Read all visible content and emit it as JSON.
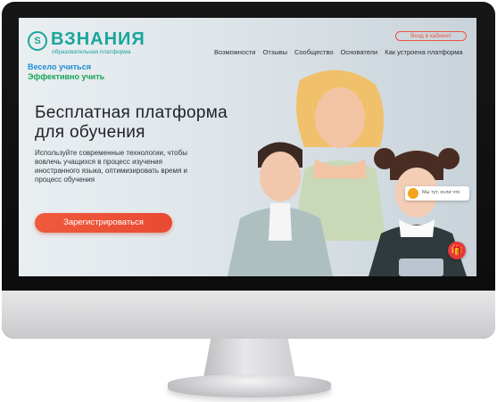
{
  "brand": {
    "logo_mark": "S",
    "name": "ВЗНАНИЯ",
    "subtitle": "образовательная платформа"
  },
  "header": {
    "login_label": "Вход в кабинет",
    "nav": [
      "Возможности",
      "Отзывы",
      "Сообщество",
      "Основатели",
      "Как устроена платформа"
    ]
  },
  "slogan": {
    "line1": "Весело учиться",
    "line2": "Эффективно учить"
  },
  "hero": {
    "title": "Бесплатная платформа для обучения",
    "description": "Используйте современные технологии, чтобы вовлечь учащихся в процесс изучения иностранного языка, оптимизировать время и процесс обучения",
    "register_label": "Зарегистрироваться"
  },
  "chat": {
    "text": "Мы тут, если что"
  },
  "gift": {
    "icon": "gift-icon",
    "glyph": "🎁"
  },
  "colors": {
    "brand_teal": "#1aa59a",
    "accent_orange": "#e9563e",
    "slogan_blue": "#1e8fd4",
    "slogan_green": "#1aa35a",
    "gift_red": "#e6383c"
  }
}
